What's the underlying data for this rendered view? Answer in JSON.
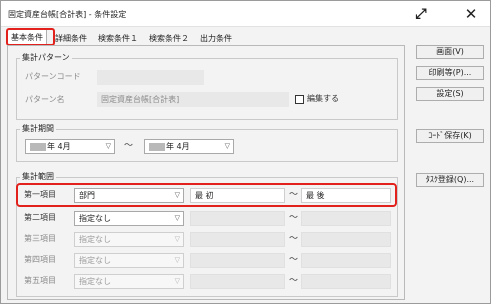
{
  "window": {
    "title": "固定資産台帳[合計表] - 条件設定",
    "expand_icon": "expand-arrows-icon",
    "close_icon": "close-icon"
  },
  "tabs": [
    {
      "label": "基本条件",
      "active": true
    },
    {
      "label": "詳細条件",
      "active": false
    },
    {
      "label": "検索条件１",
      "active": false
    },
    {
      "label": "検索条件２",
      "active": false
    },
    {
      "label": "出力条件",
      "active": false
    }
  ],
  "pattern_group": {
    "title": "集計パターン",
    "code_label": "パターンコード",
    "code_value": "",
    "name_label": "パターン名",
    "name_value": "固定資産台帳[合計表]",
    "edit_checkbox_label": "編集する",
    "edit_checked": false
  },
  "period_group": {
    "title": "集計期間",
    "from_value": "年 4月",
    "to_value": "年 4月",
    "tilde": "～"
  },
  "range_group": {
    "title": "集計範囲",
    "rows": [
      {
        "label": "第一項目",
        "item": "部門",
        "from": "最 初",
        "tilde": "～",
        "to": "最 後",
        "enabled": true
      },
      {
        "label": "第二項目",
        "item": "指定なし",
        "from": "",
        "tilde": "～",
        "to": "",
        "enabled": true
      },
      {
        "label": "第三項目",
        "item": "指定なし",
        "from": "",
        "tilde": "～",
        "to": "",
        "enabled": false
      },
      {
        "label": "第四項目",
        "item": "指定なし",
        "from": "",
        "tilde": "～",
        "to": "",
        "enabled": false
      },
      {
        "label": "第五項目",
        "item": "指定なし",
        "from": "",
        "tilde": "～",
        "to": "",
        "enabled": false
      }
    ]
  },
  "buttons": {
    "screen": "画面(V)",
    "print": "印刷等(P)...",
    "settings": "設定(S)",
    "code_save": "ｺｰﾄﾞ保存(K)",
    "task_register": "ﾀｽｸ登録(Q)..."
  },
  "colors": {
    "highlight": "#e2211c",
    "window_bg": "#f3f3f3"
  }
}
